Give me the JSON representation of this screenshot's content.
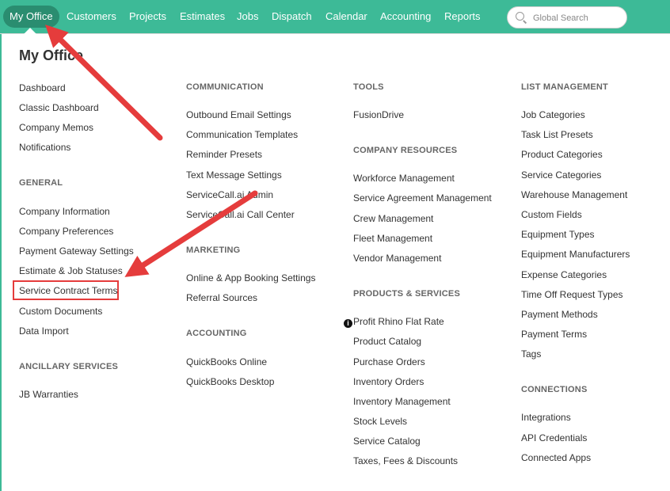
{
  "nav": {
    "items": [
      "My Office",
      "Customers",
      "Projects",
      "Estimates",
      "Jobs",
      "Dispatch",
      "Calendar",
      "Accounting",
      "Reports"
    ],
    "active": "My Office"
  },
  "search": {
    "placeholder": "Global Search"
  },
  "panel": {
    "title": "My Office"
  },
  "columns": {
    "col1": {
      "top_links": [
        "Dashboard",
        "Classic Dashboard",
        "Company Memos",
        "Notifications"
      ],
      "general_heading": "GENERAL",
      "general": [
        "Company Information",
        "Company Preferences",
        "Payment Gateway Settings",
        "Estimate & Job Statuses",
        "Service Contract Terms",
        "Custom Documents",
        "Data Import"
      ],
      "ancillary_heading": "ANCILLARY SERVICES",
      "ancillary": [
        "JB Warranties"
      ]
    },
    "col2": {
      "communication_heading": "COMMUNICATION",
      "communication": [
        "Outbound Email Settings",
        "Communication Templates",
        "Reminder Presets",
        "Text Message Settings",
        "ServiceCall.ai Admin",
        "ServiceCall.ai Call Center"
      ],
      "marketing_heading": "MARKETING",
      "marketing": [
        "Online & App Booking Settings",
        "Referral Sources"
      ],
      "accounting_heading": "ACCOUNTING",
      "accounting": [
        "QuickBooks Online",
        "QuickBooks Desktop"
      ]
    },
    "col3": {
      "tools_heading": "TOOLS",
      "tools": [
        "FusionDrive"
      ],
      "resources_heading": "COMPANY RESOURCES",
      "resources": [
        "Workforce Management",
        "Service Agreement Management",
        "Crew Management",
        "Fleet Management",
        "Vendor Management"
      ],
      "products_heading": "PRODUCTS & SERVICES",
      "products": [
        "Profit Rhino Flat Rate",
        "Product Catalog",
        "Purchase Orders",
        "Inventory Orders",
        "Inventory Management",
        "Stock Levels",
        "Service Catalog",
        "Taxes, Fees & Discounts"
      ]
    },
    "col4": {
      "list_heading": "LIST MANAGEMENT",
      "list": [
        "Job Categories",
        "Task List Presets",
        "Product Categories",
        "Service Categories",
        "Warehouse Management",
        "Custom Fields",
        "Equipment Types",
        "Equipment Manufacturers",
        "Expense Categories",
        "Time Off Request Types",
        "Payment Methods",
        "Payment Terms",
        "Tags"
      ],
      "connections_heading": "CONNECTIONS",
      "connections": [
        "Integrations",
        "API Credentials",
        "Connected Apps"
      ]
    }
  },
  "colors": {
    "brand": "#3dba97",
    "active_pill": "#2a8d70",
    "annotation": "#e53c3c"
  }
}
